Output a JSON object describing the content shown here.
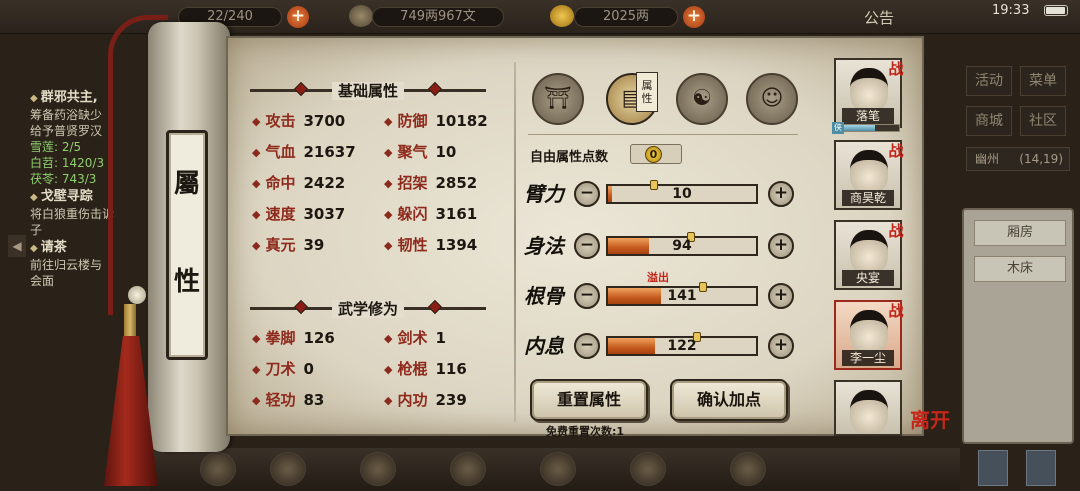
{
  "topbar": {
    "stamina": "22/240",
    "silver": "749两967文",
    "gold": "2025两",
    "notice": "公告",
    "time": "19:33",
    "battery_level": 0.95
  },
  "quests": [
    {
      "title": "群邪共主,",
      "lines": [
        "筹备药浴缺少",
        "给予普贤罗汉"
      ],
      "items": [
        "雪莲: 2/5",
        "白苕: 1420/3",
        "茯苓: 743/3"
      ]
    },
    {
      "title": "戈壁寻踪",
      "lines": [
        "将白狼重伤击诉",
        "子"
      ],
      "items": []
    },
    {
      "title": "请茶",
      "lines": [
        "前往归云楼与",
        "会面"
      ],
      "items": []
    }
  ],
  "side": {
    "buttons": [
      "活动",
      "菜单",
      "商城",
      "社区"
    ],
    "location": "幽州",
    "coords": "(14,19)",
    "rooms": [
      "厢房",
      "木床"
    ]
  },
  "title": {
    "chars": [
      "屬",
      "性"
    ]
  },
  "basic": {
    "header": "基础属性",
    "stats": [
      {
        "name": "攻击",
        "value": "3700"
      },
      {
        "name": "防御",
        "value": "10182"
      },
      {
        "name": "气血",
        "value": "21637"
      },
      {
        "name": "聚气",
        "value": "10"
      },
      {
        "name": "命中",
        "value": "2422"
      },
      {
        "name": "招架",
        "value": "2852"
      },
      {
        "name": "速度",
        "value": "3037"
      },
      {
        "name": "躲闪",
        "value": "3161"
      },
      {
        "name": "真元",
        "value": "39"
      },
      {
        "name": "韧性",
        "value": "1394"
      }
    ]
  },
  "martial": {
    "header": "武学修为",
    "stats": [
      {
        "name": "拳脚",
        "value": "126"
      },
      {
        "name": "剑术",
        "value": "1"
      },
      {
        "name": "刀术",
        "value": "0"
      },
      {
        "name": "枪棍",
        "value": "116"
      },
      {
        "name": "轻功",
        "value": "83"
      },
      {
        "name": "内功",
        "value": "239"
      }
    ]
  },
  "categories": {
    "tag": "属性"
  },
  "free_points": {
    "label": "自由属性点数",
    "value": "0"
  },
  "attributes": [
    {
      "name": "臂力",
      "value": "10",
      "fill": 0.03
    },
    {
      "name": "身法",
      "value": "94",
      "fill": 0.28
    },
    {
      "name": "根骨",
      "value": "141",
      "fill": 0.36
    },
    {
      "name": "内息",
      "value": "122",
      "fill": 0.32
    }
  ],
  "overflow_label": "溢出",
  "buttons": {
    "reset": "重置属性",
    "confirm": "确认加点",
    "free_reset": "免费重置次数:1"
  },
  "characters": [
    {
      "name": "落笔",
      "war": "战"
    },
    {
      "name": "商昊乾",
      "war": "战"
    },
    {
      "name": "央宴",
      "war": "战"
    },
    {
      "name": "李一尘",
      "war": "战"
    },
    {
      "name": "",
      "war": ""
    }
  ],
  "leave": "离开",
  "colors": {
    "accent": "#8e2a1c",
    "bar": "#c55a1e",
    "paper": "#e4ded0"
  }
}
